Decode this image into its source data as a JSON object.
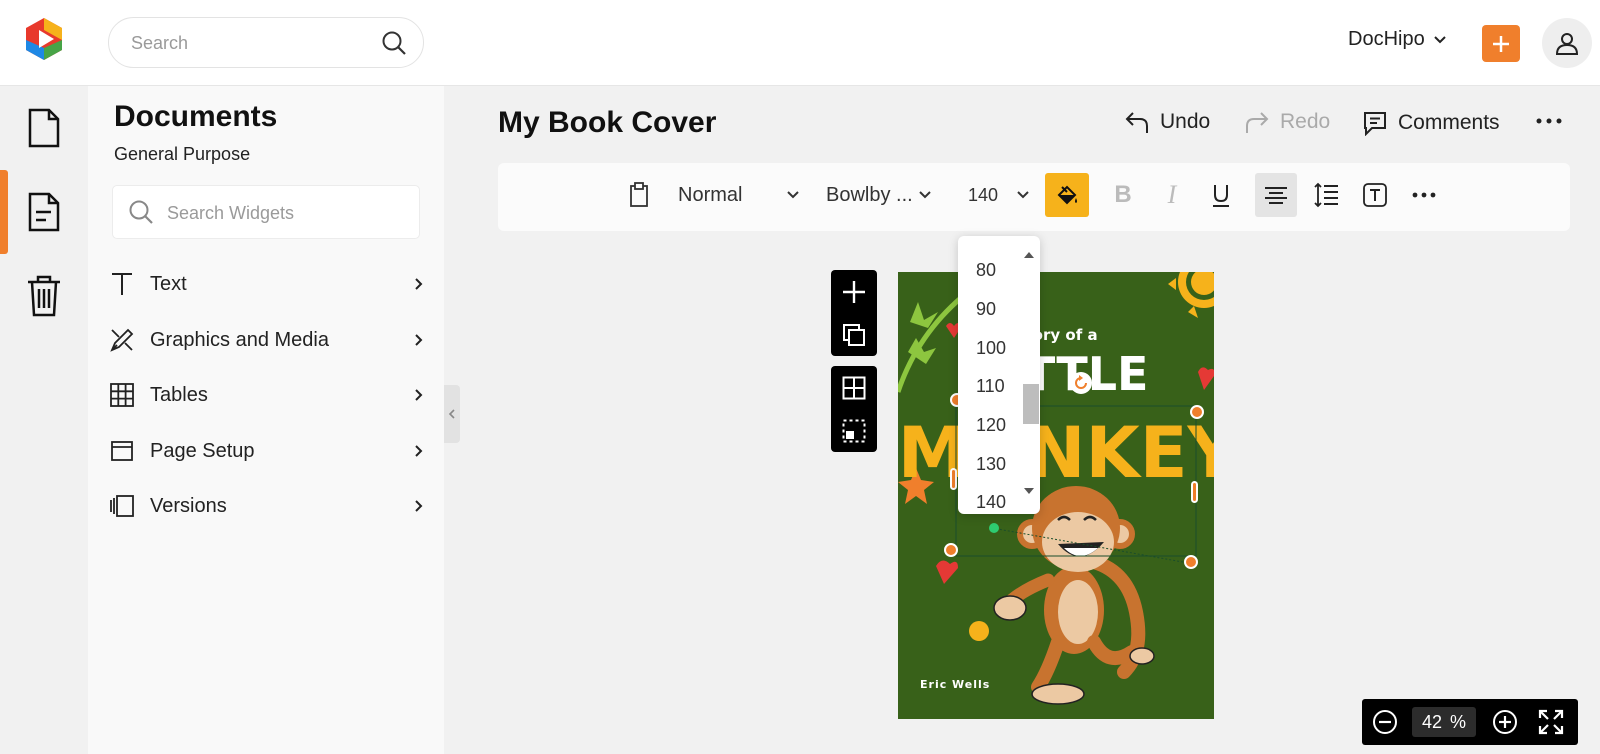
{
  "topbar": {
    "search_placeholder": "Search",
    "account_name": "DocHipo",
    "brand_colors": {
      "accent": "#f07f2c",
      "logo_red": "#e8392c",
      "logo_yellow": "#f6b21b",
      "logo_green": "#47a447",
      "logo_blue": "#1e88e5"
    }
  },
  "rail": {
    "items": [
      {
        "name": "documents",
        "icon": "document-icon"
      },
      {
        "name": "my-docs",
        "icon": "file-text-icon",
        "active": true
      },
      {
        "name": "trash",
        "icon": "trash-icon"
      }
    ]
  },
  "panel": {
    "title": "Documents",
    "subtitle": "General Purpose",
    "search_placeholder": "Search Widgets",
    "items": [
      {
        "label": "Text",
        "icon": "text-icon"
      },
      {
        "label": "Graphics and Media",
        "icon": "graphics-icon"
      },
      {
        "label": "Tables",
        "icon": "table-icon"
      },
      {
        "label": "Page Setup",
        "icon": "page-setup-icon"
      },
      {
        "label": "Versions",
        "icon": "versions-icon"
      }
    ]
  },
  "editor": {
    "doc_title": "My Book Cover",
    "undo_label": "Undo",
    "redo_label": "Redo",
    "comments_label": "Comments"
  },
  "toolbar": {
    "style_value": "Normal",
    "font_value": "Bowlby ...",
    "size_value": "140",
    "fill_color": "#f6b21b"
  },
  "size_dropdown": {
    "options": [
      "80",
      "90",
      "100",
      "110",
      "120",
      "130",
      "140"
    ]
  },
  "cover": {
    "title_line1": "The Story of a",
    "title_line2": "LITTLE",
    "title_line3": "MONKEY",
    "author": "Eric Wells",
    "bg_color": "#386119",
    "title_color": "#f6b21b"
  },
  "zoom": {
    "value": "42",
    "unit": "%"
  }
}
